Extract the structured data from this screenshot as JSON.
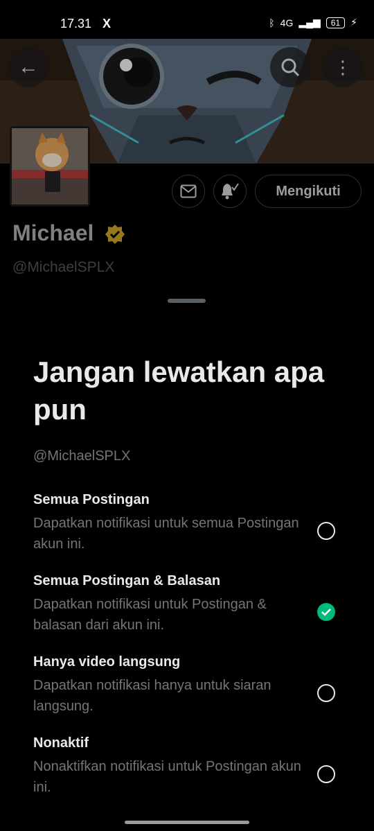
{
  "status_bar": {
    "time": "17.31",
    "app_icon": "X",
    "network": "4G",
    "battery": "61"
  },
  "profile": {
    "name": "Michael",
    "handle": "@MichaelSPLX",
    "follow_label": "Mengikuti",
    "verified_color": "#c9a227"
  },
  "sheet": {
    "title": "Jangan lewatkan apa pun",
    "handle": "@MichaelSPLX",
    "options": [
      {
        "title": "Semua Postingan",
        "description": "Dapatkan notifikasi untuk semua Postingan akun ini.",
        "selected": false
      },
      {
        "title": "Semua Postingan & Balasan",
        "description": "Dapatkan notifikasi untuk Postingan & balasan dari akun ini.",
        "selected": true
      },
      {
        "title": "Hanya video langsung",
        "description": "Dapatkan notifikasi hanya untuk siaran langsung.",
        "selected": false
      },
      {
        "title": "Nonaktif",
        "description": "Nonaktifkan notifikasi untuk Postingan akun ini.",
        "selected": false
      }
    ]
  },
  "colors": {
    "accent_selected": "#00ba7c",
    "background": "#000000"
  }
}
